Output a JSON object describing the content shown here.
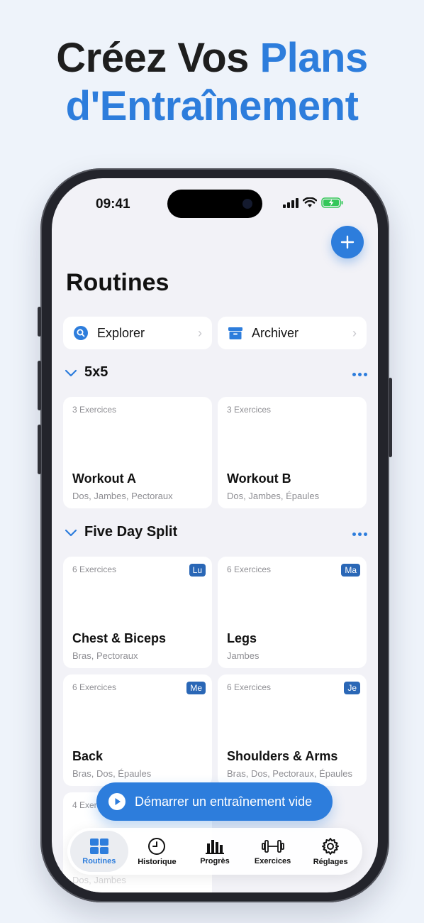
{
  "headline": {
    "dark": "Créez Vos ",
    "blue1": "Plans",
    "blue2": "d'Entraînement"
  },
  "status": {
    "time": "09:41"
  },
  "page_title": "Routines",
  "quick_actions": [
    {
      "label": "Explorer",
      "icon": "search-icon"
    },
    {
      "label": "Archiver",
      "icon": "archive-box-icon"
    }
  ],
  "sections": [
    {
      "name": "5x5",
      "cards": [
        {
          "count": "3 Exercices",
          "name": "Workout A",
          "muscles": "Dos, Jambes, Pectoraux"
        },
        {
          "count": "3 Exercices",
          "name": "Workout B",
          "muscles": "Dos, Jambes, Épaules"
        }
      ]
    },
    {
      "name": "Five Day Split",
      "cards": [
        {
          "count": "6 Exercices",
          "name": "Chest & Biceps",
          "muscles": "Bras, Pectoraux",
          "day": "Lu"
        },
        {
          "count": "6 Exercices",
          "name": "Legs",
          "muscles": "Jambes",
          "day": "Ma"
        },
        {
          "count": "6 Exercices",
          "name": "Back",
          "muscles": "Bras, Dos, Épaules",
          "day": "Me"
        },
        {
          "count": "6 Exercices",
          "name": "Shoulders & Arms",
          "muscles": "Bras, Dos, Pectoraux, Épaules",
          "day": "Je"
        },
        {
          "count": "4 Exercices",
          "name": "",
          "muscles": "Dos, Jambes"
        }
      ]
    }
  ],
  "start_button": {
    "label": "Démarrer un entraînement vide"
  },
  "tabbar": [
    {
      "label": "Routines",
      "icon": "grid-icon",
      "active": true
    },
    {
      "label": "Historique",
      "icon": "clock-icon",
      "active": false
    },
    {
      "label": "Progrès",
      "icon": "bar-chart-icon",
      "active": false
    },
    {
      "label": "Exercices",
      "icon": "dumbbell-icon",
      "active": false
    },
    {
      "label": "Réglages",
      "icon": "gear-icon",
      "active": false
    }
  ],
  "colors": {
    "accent": "#2d7ddc",
    "badge": "#2a67b6",
    "background": "#f2f2f7",
    "headline_dark": "#1e1e1e"
  }
}
